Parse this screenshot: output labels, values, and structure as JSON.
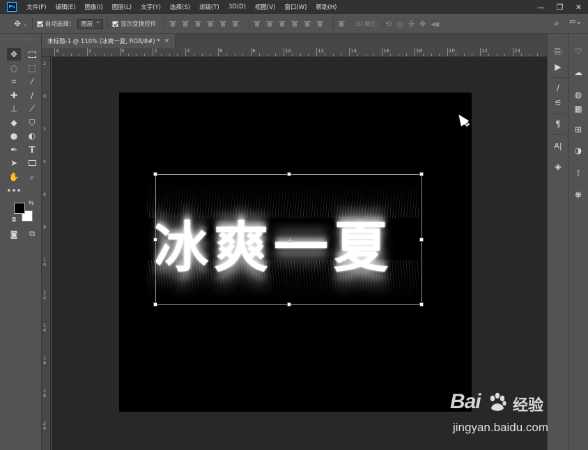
{
  "app": {
    "logo": "Ps"
  },
  "menubar": {
    "items": [
      "文件(F)",
      "编辑(E)",
      "图像(I)",
      "图层(L)",
      "文字(Y)",
      "选择(S)",
      "滤镜(T)",
      "3D(D)",
      "视图(V)",
      "窗口(W)",
      "帮助(H)"
    ]
  },
  "window_controls": {
    "minimize": "—",
    "restore": "❐",
    "close": "✕"
  },
  "options_bar": {
    "auto_select_label": "自动选择：",
    "auto_select_target": "图层",
    "show_transform_label": "显示变换控件",
    "mode_3d_label": "3D 模式："
  },
  "document": {
    "tab_title": "未标题-1 @ 110% (冰爽一夏, RGB/8#) *",
    "tab_close": "×",
    "canvas_text": "冰爽一夏",
    "canvas_color": "#000000",
    "text_color": "#ffffff"
  },
  "rulers": {
    "top": [
      "4",
      "2",
      "0",
      "2",
      "4",
      "6",
      "8",
      "10",
      "12",
      "14",
      "16",
      "18",
      "20",
      "22",
      "24"
    ],
    "left": [
      "2",
      "0",
      "2",
      "4",
      "6",
      "8",
      "1 0",
      "1 2",
      "1 4",
      "1 6",
      "1 8",
      "2 0"
    ]
  },
  "colors": {
    "foreground": "#000000",
    "background": "#ffffff",
    "workspace": "#282828",
    "ui": "#535353"
  },
  "watermark": {
    "brand": "Bai",
    "suffix": "经验",
    "url": "jingyan.baidu.com"
  }
}
